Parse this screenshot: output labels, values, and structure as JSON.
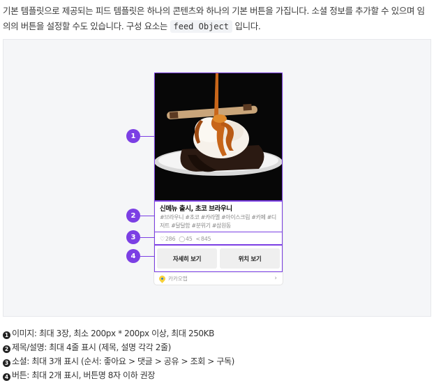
{
  "intro": {
    "text1": "기본 템플릿으로 제공되는 피드 템플릿은 하나의 콘텐츠와 하나의 기본 버튼을 가집니다. 소셜 정보를 추가할 수 있으며 임의의 버튼을 설정할 수도 있습니다. 구성 요소는 ",
    "code": "feed Object",
    "text2": " 입니다."
  },
  "card": {
    "title": "신메뉴 출시, 초코 브라우니",
    "description": "#브라우니 #초코 #카라멜 #아이스크림 #카페 #디저트 #달달함 #분위기 #삼원동",
    "social": {
      "likes_icon": "♡",
      "likes": "286",
      "comments_icon": "◯",
      "comments": "45",
      "shares_icon": "<",
      "shares": "845"
    },
    "buttons": [
      "자세히 보기",
      "위치 보기"
    ],
    "footer_label": "카카오맵",
    "footer_chevron": "›"
  },
  "markers": [
    "1",
    "2",
    "3",
    "4"
  ],
  "accent_color": "#7b3fe4",
  "notes": [
    {
      "num": "1",
      "text": "이미지: 최대 3장, 최소 200px * 200px 이상, 최대 250KB"
    },
    {
      "num": "2",
      "text": "제목/설명: 최대 4줄 표시 (제목, 설명 각각 2줄)"
    },
    {
      "num": "3",
      "text": "소셜: 최대 3개 표시 (순서: 좋아요 > 댓글 > 공유 > 조회 > 구독)"
    },
    {
      "num": "4",
      "text": "버튼: 최대 2개 표시, 버튼명 8자 이하 권장"
    }
  ]
}
